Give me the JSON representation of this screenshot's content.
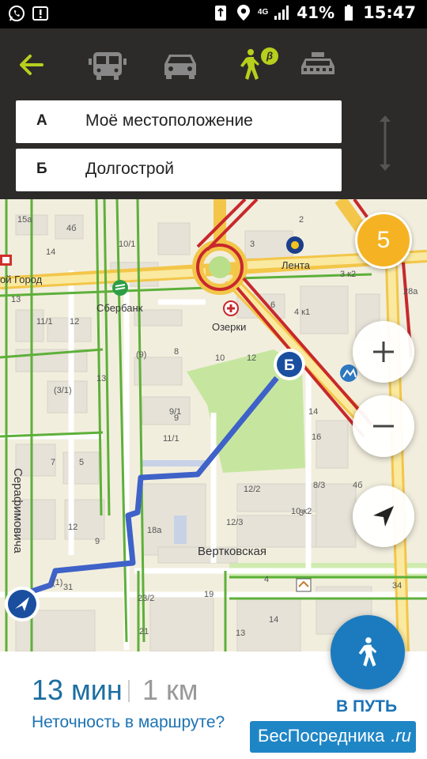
{
  "status_bar": {
    "icons_left": [
      "whatsapp-icon",
      "notification-icon"
    ],
    "icons_right": [
      "recycle-icon",
      "location-icon",
      "signal-icon",
      "battery-icon"
    ],
    "network": "4G",
    "battery": "41%",
    "time": "15:47"
  },
  "transport_modes": {
    "items": [
      "back",
      "public-transport",
      "car",
      "pedestrian",
      "taxi"
    ],
    "active": "pedestrian",
    "beta_badge": "β",
    "accent_color": "#b7cf1d"
  },
  "route": {
    "from": {
      "letter": "А",
      "value": "Моё местоположение"
    },
    "to": {
      "letter": "Б",
      "value": "Долгострой"
    }
  },
  "map": {
    "streets": [
      "Серафимовича",
      "Вертковская"
    ],
    "pois": [
      "Сбербанк",
      "Озерки",
      "Лента"
    ],
    "district_label": "ой Город",
    "destination_marker": "Б",
    "counter": "5",
    "building_numbers": [
      "15а",
      "4б",
      "14",
      "10/1",
      "3",
      "2",
      "3 к2",
      "28а",
      "13",
      "11/1",
      "12",
      "4 к1",
      "6",
      "(9)",
      "8",
      "10",
      "12",
      "(3/1)",
      "13",
      "9/1",
      "14",
      "16",
      "11/1",
      "7",
      "5",
      "12/2",
      "8/3",
      "4б",
      "10 к2",
      "12/3",
      "18а",
      "12",
      "9",
      "31",
      "23/2",
      "19",
      "13",
      "14",
      "34",
      "21",
      "9",
      "(1)",
      "4",
      "3"
    ],
    "route_color": "#3e62c8",
    "road_color": "#f7d66a",
    "traffic_color": "#c8282c"
  },
  "summary": {
    "time": "13 мин",
    "distance": "1 км",
    "warning": "Неточность в маршруте?",
    "go_label": "В ПУТЬ"
  },
  "watermark": {
    "text": "БесПосредника",
    "suffix": ".ru"
  }
}
